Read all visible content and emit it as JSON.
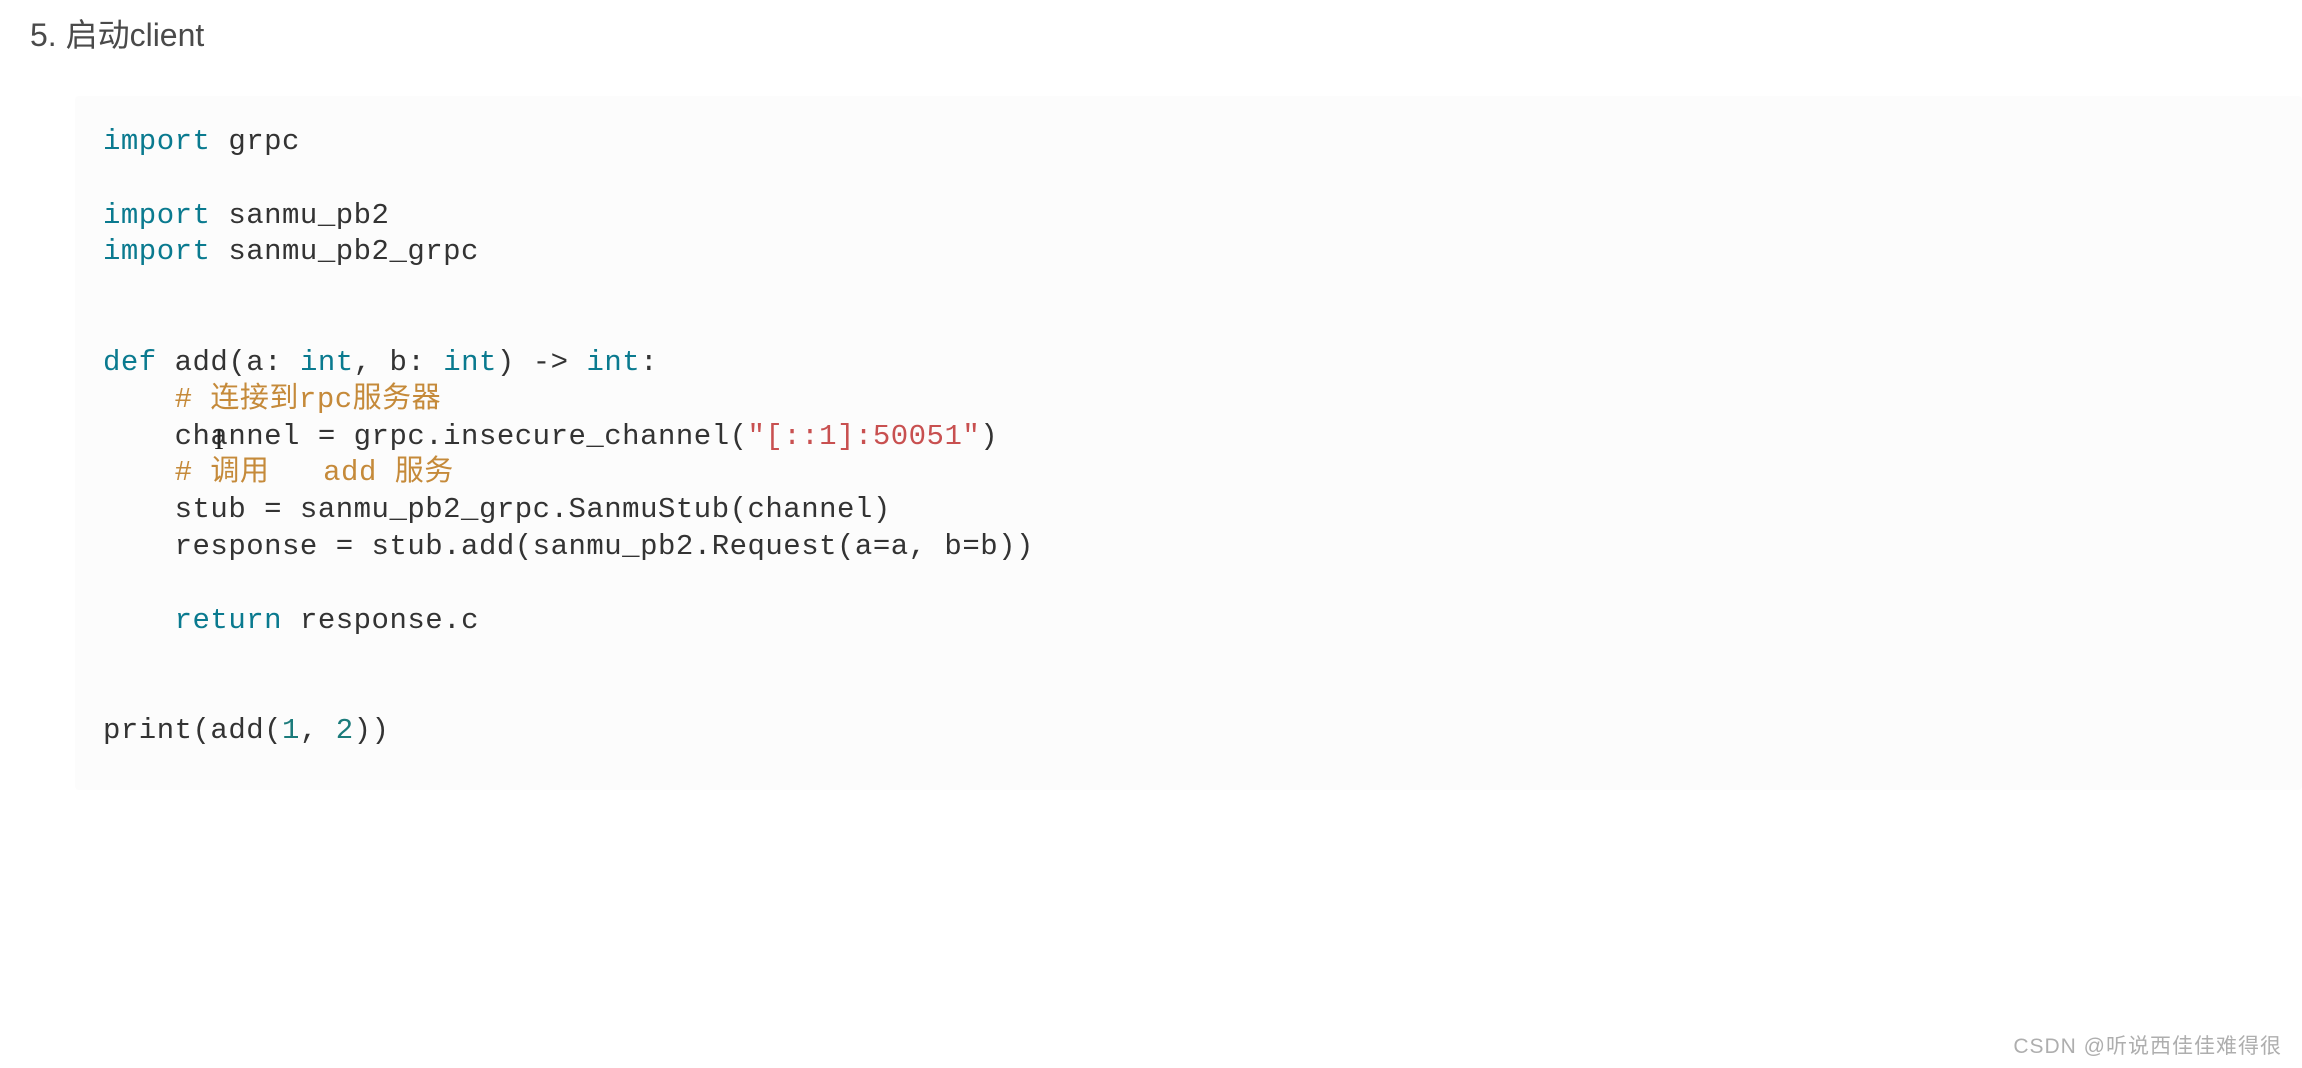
{
  "heading": "5. 启动client",
  "code": {
    "l1_kw": "import",
    "l1_rest": " grpc",
    "l3_kw": "import",
    "l3_rest": " sanmu_pb2",
    "l4_kw": "import",
    "l4_rest": " sanmu_pb2_grpc",
    "l6_def": "def",
    "l6_name": " add",
    "l6_p1": "(a: ",
    "l6_int1": "int",
    "l6_comma": ", b: ",
    "l6_int2": "int",
    "l6_arrow": ") -> ",
    "l6_int3": "int",
    "l6_colon": ":",
    "l7_indent": "    ",
    "l7_cm": "# 连接到rpc服务器",
    "l8_indent": "    channel = grpc.insecure_channel(",
    "l8_str": "\"[::1]:50051\"",
    "l8_end": ")",
    "l9_indent": "    ",
    "l9_cm": "# 调用   add 服务",
    "l10": "    stub = sanmu_pb2_grpc.SanmuStub(channel)",
    "l11": "    response = stub.add(sanmu_pb2.Request(a=a, b=b))",
    "l13_indent": "    ",
    "l13_kw": "return",
    "l13_rest": " response.c",
    "l16_a": "print(add(",
    "l16_n1": "1",
    "l16_c": ", ",
    "l16_n2": "2",
    "l16_end": "))"
  },
  "cursor_glyph": "I",
  "watermark": "CSDN @听说西佳佳难得很"
}
